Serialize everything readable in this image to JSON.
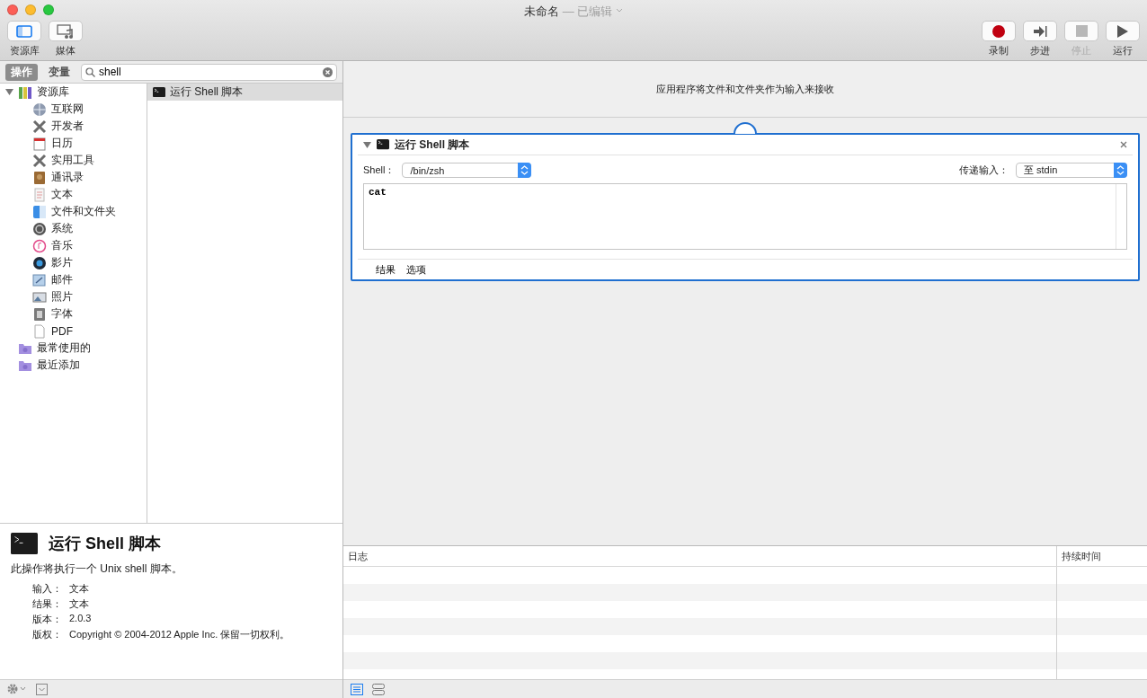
{
  "window": {
    "title": "未命名",
    "subtitle": "— 已编辑"
  },
  "toolbar_left": [
    {
      "label": "资源库",
      "kind": "library",
      "selected": true
    },
    {
      "label": "媒体",
      "kind": "media",
      "selected": false
    }
  ],
  "toolbar_right": [
    {
      "label": "录制",
      "kind": "record",
      "disabled": false
    },
    {
      "label": "步进",
      "kind": "step",
      "disabled": false
    },
    {
      "label": "停止",
      "kind": "stop",
      "disabled": true
    },
    {
      "label": "运行",
      "kind": "run",
      "disabled": false
    }
  ],
  "tabs": [
    {
      "label": "操作",
      "selected": true
    },
    {
      "label": "变量",
      "selected": false
    }
  ],
  "search": {
    "value": "shell"
  },
  "library": [
    {
      "label": "资源库",
      "kind": "library",
      "expanded": true,
      "children": [
        {
          "label": "互联网",
          "kind": "globe"
        },
        {
          "label": "开发者",
          "kind": "tools"
        },
        {
          "label": "日历",
          "kind": "calendar"
        },
        {
          "label": "实用工具",
          "kind": "tools"
        },
        {
          "label": "通讯录",
          "kind": "contacts"
        },
        {
          "label": "文本",
          "kind": "text"
        },
        {
          "label": "文件和文件夹",
          "kind": "finder"
        },
        {
          "label": "系统",
          "kind": "system"
        },
        {
          "label": "音乐",
          "kind": "music"
        },
        {
          "label": "影片",
          "kind": "movie"
        },
        {
          "label": "邮件",
          "kind": "mail"
        },
        {
          "label": "照片",
          "kind": "photo"
        },
        {
          "label": "字体",
          "kind": "font"
        },
        {
          "label": "PDF",
          "kind": "pdf"
        }
      ]
    },
    {
      "label": "最常使用的",
      "kind": "smart-folder"
    },
    {
      "label": "最近添加",
      "kind": "smart-folder"
    }
  ],
  "actions": [
    {
      "label": "运行 Shell 脚本",
      "selected": true
    }
  ],
  "description": {
    "title": "运行 Shell 脚本",
    "text": "此操作将执行一个 Unix shell 脚本。",
    "fields": [
      {
        "label": "输入：",
        "value": "文本"
      },
      {
        "label": "结果：",
        "value": "文本"
      },
      {
        "label": "版本：",
        "value": "2.0.3"
      },
      {
        "label": "版权：",
        "value": "Copyright © 2004-2012 Apple Inc.  保留一切权利。"
      }
    ]
  },
  "workflow": {
    "header": "应用程序将文件和文件夹作为输入来接收",
    "actions": [
      {
        "title": "运行 Shell 脚本",
        "expanded": true,
        "shell_label": "Shell：",
        "shell_value": "/bin/zsh",
        "pass_label": "传递输入：",
        "pass_value": "至 stdin",
        "script": "cat",
        "footer_tabs": [
          "结果",
          "选项"
        ]
      }
    ]
  },
  "log": {
    "columns": [
      "日志",
      "持续时间"
    ]
  },
  "view_buttons": [
    {
      "kind": "list",
      "selected": true
    },
    {
      "kind": "flow",
      "selected": false
    }
  ]
}
